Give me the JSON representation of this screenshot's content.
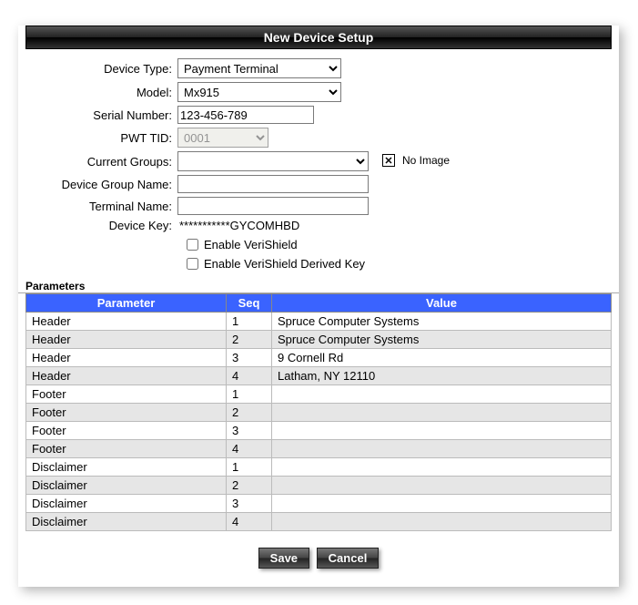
{
  "title": "New Device Setup",
  "form": {
    "device_type": {
      "label": "Device Type:",
      "value": "Payment Terminal"
    },
    "model": {
      "label": "Model:",
      "value": "Mx915"
    },
    "serial_number": {
      "label": "Serial Number:",
      "value": "123-456-789"
    },
    "pwt_tid": {
      "label": "PWT TID:",
      "value": "0001"
    },
    "current_groups": {
      "label": "Current Groups:",
      "value": ""
    },
    "device_group_name": {
      "label": "Device Group Name:",
      "value": ""
    },
    "terminal_name": {
      "label": "Terminal Name:",
      "value": ""
    },
    "device_key": {
      "label": "Device Key:",
      "value": "***********GYCOMHBD"
    },
    "enable_verishield": {
      "label": "Enable VeriShield"
    },
    "enable_verishield_derived": {
      "label": "Enable VeriShield Derived Key"
    }
  },
  "no_image": "No Image",
  "parameters": {
    "section": "Parameters",
    "headers": {
      "parameter": "Parameter",
      "seq": "Seq",
      "value": "Value"
    },
    "rows": [
      {
        "param": "Header",
        "seq": "1",
        "value": "Spruce Computer Systems"
      },
      {
        "param": "Header",
        "seq": "2",
        "value": "Spruce Computer Systems"
      },
      {
        "param": "Header",
        "seq": "3",
        "value": "9 Cornell Rd"
      },
      {
        "param": "Header",
        "seq": "4",
        "value": "Latham, NY 12110"
      },
      {
        "param": "Footer",
        "seq": "1",
        "value": ""
      },
      {
        "param": "Footer",
        "seq": "2",
        "value": ""
      },
      {
        "param": "Footer",
        "seq": "3",
        "value": ""
      },
      {
        "param": "Footer",
        "seq": "4",
        "value": ""
      },
      {
        "param": "Disclaimer",
        "seq": "1",
        "value": ""
      },
      {
        "param": "Disclaimer",
        "seq": "2",
        "value": ""
      },
      {
        "param": "Disclaimer",
        "seq": "3",
        "value": ""
      },
      {
        "param": "Disclaimer",
        "seq": "4",
        "value": ""
      }
    ]
  },
  "buttons": {
    "save": "Save",
    "cancel": "Cancel"
  }
}
